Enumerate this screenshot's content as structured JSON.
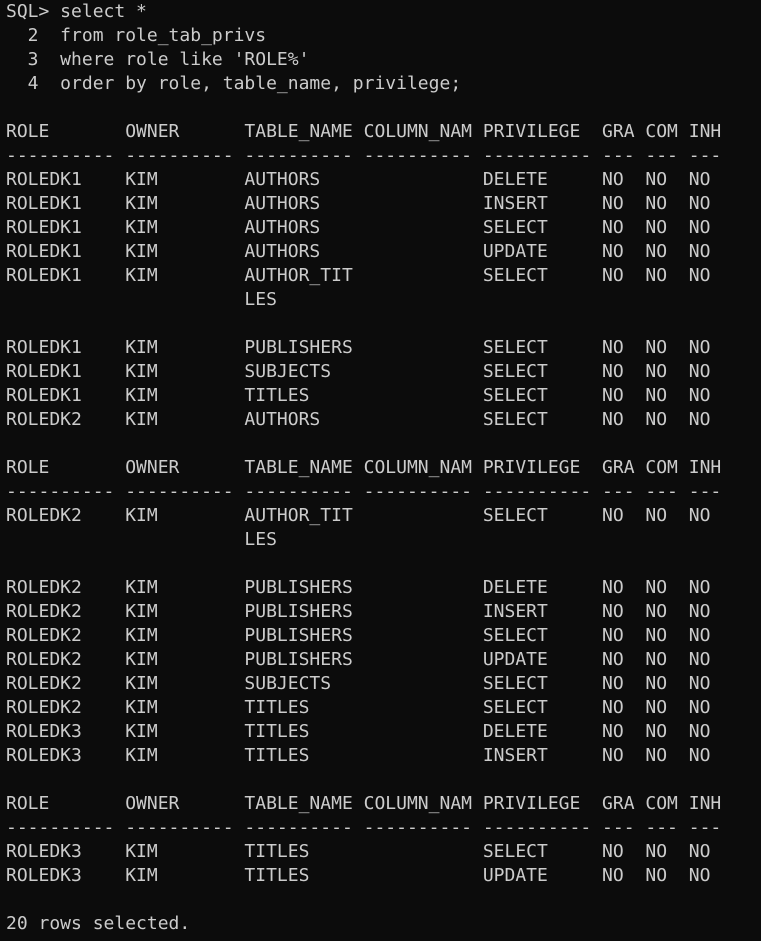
{
  "window": {
    "background": "#0c0c0c",
    "foreground": "#cccccc"
  },
  "lines": [
    "SQL> select *",
    "  2  from role_tab_privs",
    "  3  where role like 'ROLE%'",
    "  4  order by role, table_name, privilege;",
    "",
    "ROLE       OWNER      TABLE_NAME COLUMN_NAM PRIVILEGE  GRA COM INH",
    "---------- ---------- ---------- ---------- ---------- --- --- ---",
    "ROLEDK1    KIM        AUTHORS               DELETE     NO  NO  NO",
    "ROLEDK1    KIM        AUTHORS               INSERT     NO  NO  NO",
    "ROLEDK1    KIM        AUTHORS               SELECT     NO  NO  NO",
    "ROLEDK1    KIM        AUTHORS               UPDATE     NO  NO  NO",
    "ROLEDK1    KIM        AUTHOR_TIT            SELECT     NO  NO  NO",
    "                      LES",
    "",
    "ROLEDK1    KIM        PUBLISHERS            SELECT     NO  NO  NO",
    "ROLEDK1    KIM        SUBJECTS              SELECT     NO  NO  NO",
    "ROLEDK1    KIM        TITLES                SELECT     NO  NO  NO",
    "ROLEDK2    KIM        AUTHORS               SELECT     NO  NO  NO",
    "",
    "ROLE       OWNER      TABLE_NAME COLUMN_NAM PRIVILEGE  GRA COM INH",
    "---------- ---------- ---------- ---------- ---------- --- --- ---",
    "ROLEDK2    KIM        AUTHOR_TIT            SELECT     NO  NO  NO",
    "                      LES",
    "",
    "ROLEDK2    KIM        PUBLISHERS            DELETE     NO  NO  NO",
    "ROLEDK2    KIM        PUBLISHERS            INSERT     NO  NO  NO",
    "ROLEDK2    KIM        PUBLISHERS            SELECT     NO  NO  NO",
    "ROLEDK2    KIM        PUBLISHERS            UPDATE     NO  NO  NO",
    "ROLEDK2    KIM        SUBJECTS              SELECT     NO  NO  NO",
    "ROLEDK2    KIM        TITLES                SELECT     NO  NO  NO",
    "ROLEDK3    KIM        TITLES                DELETE     NO  NO  NO",
    "ROLEDK3    KIM        TITLES                INSERT     NO  NO  NO",
    "",
    "ROLE       OWNER      TABLE_NAME COLUMN_NAM PRIVILEGE  GRA COM INH",
    "---------- ---------- ---------- ---------- ---------- --- --- ---",
    "ROLEDK3    KIM        TITLES                SELECT     NO  NO  NO",
    "ROLEDK3    KIM        TITLES                UPDATE     NO  NO  NO",
    "",
    "20 rows selected."
  ]
}
